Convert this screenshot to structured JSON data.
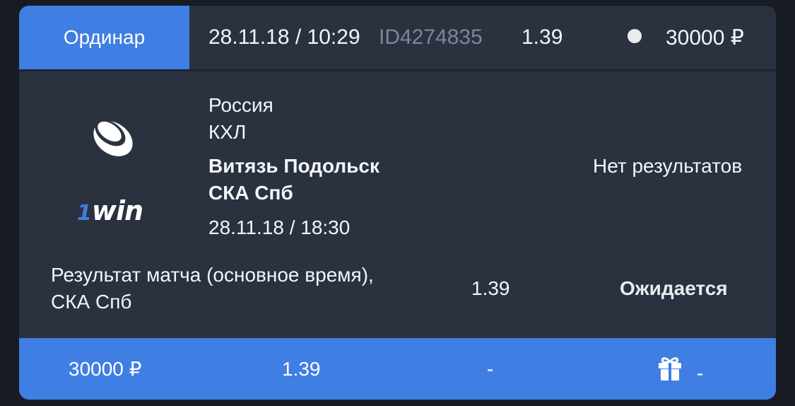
{
  "header": {
    "bet_type": "Ординар",
    "datetime": "28.11.18 / 10:29",
    "bet_id": "ID4274835",
    "odds": "1.39",
    "amount": "30000 ₽",
    "status_dot_color": "#e9ebef"
  },
  "event": {
    "sport_icon": "hockey-puck-icon",
    "brand": {
      "prefix": "1",
      "name": "win"
    },
    "country": "Россия",
    "league": "КХЛ",
    "team_home": "Витязь Подольск",
    "team_away": "СКА Спб",
    "start_time": "28.11.18 / 18:30",
    "result_text": "Нет результатов"
  },
  "selection": {
    "market": "Результат матча (основное время), СКА Спб",
    "odds": "1.39",
    "status": "Ожидается"
  },
  "footer": {
    "stake": "30000 ₽",
    "total_odds": "1.39",
    "payout": "-",
    "bonus_icon": "gift-icon",
    "bonus": "-"
  },
  "colors": {
    "accent": "#3f7ee3",
    "card": "#2a3240",
    "background": "#161b24"
  }
}
